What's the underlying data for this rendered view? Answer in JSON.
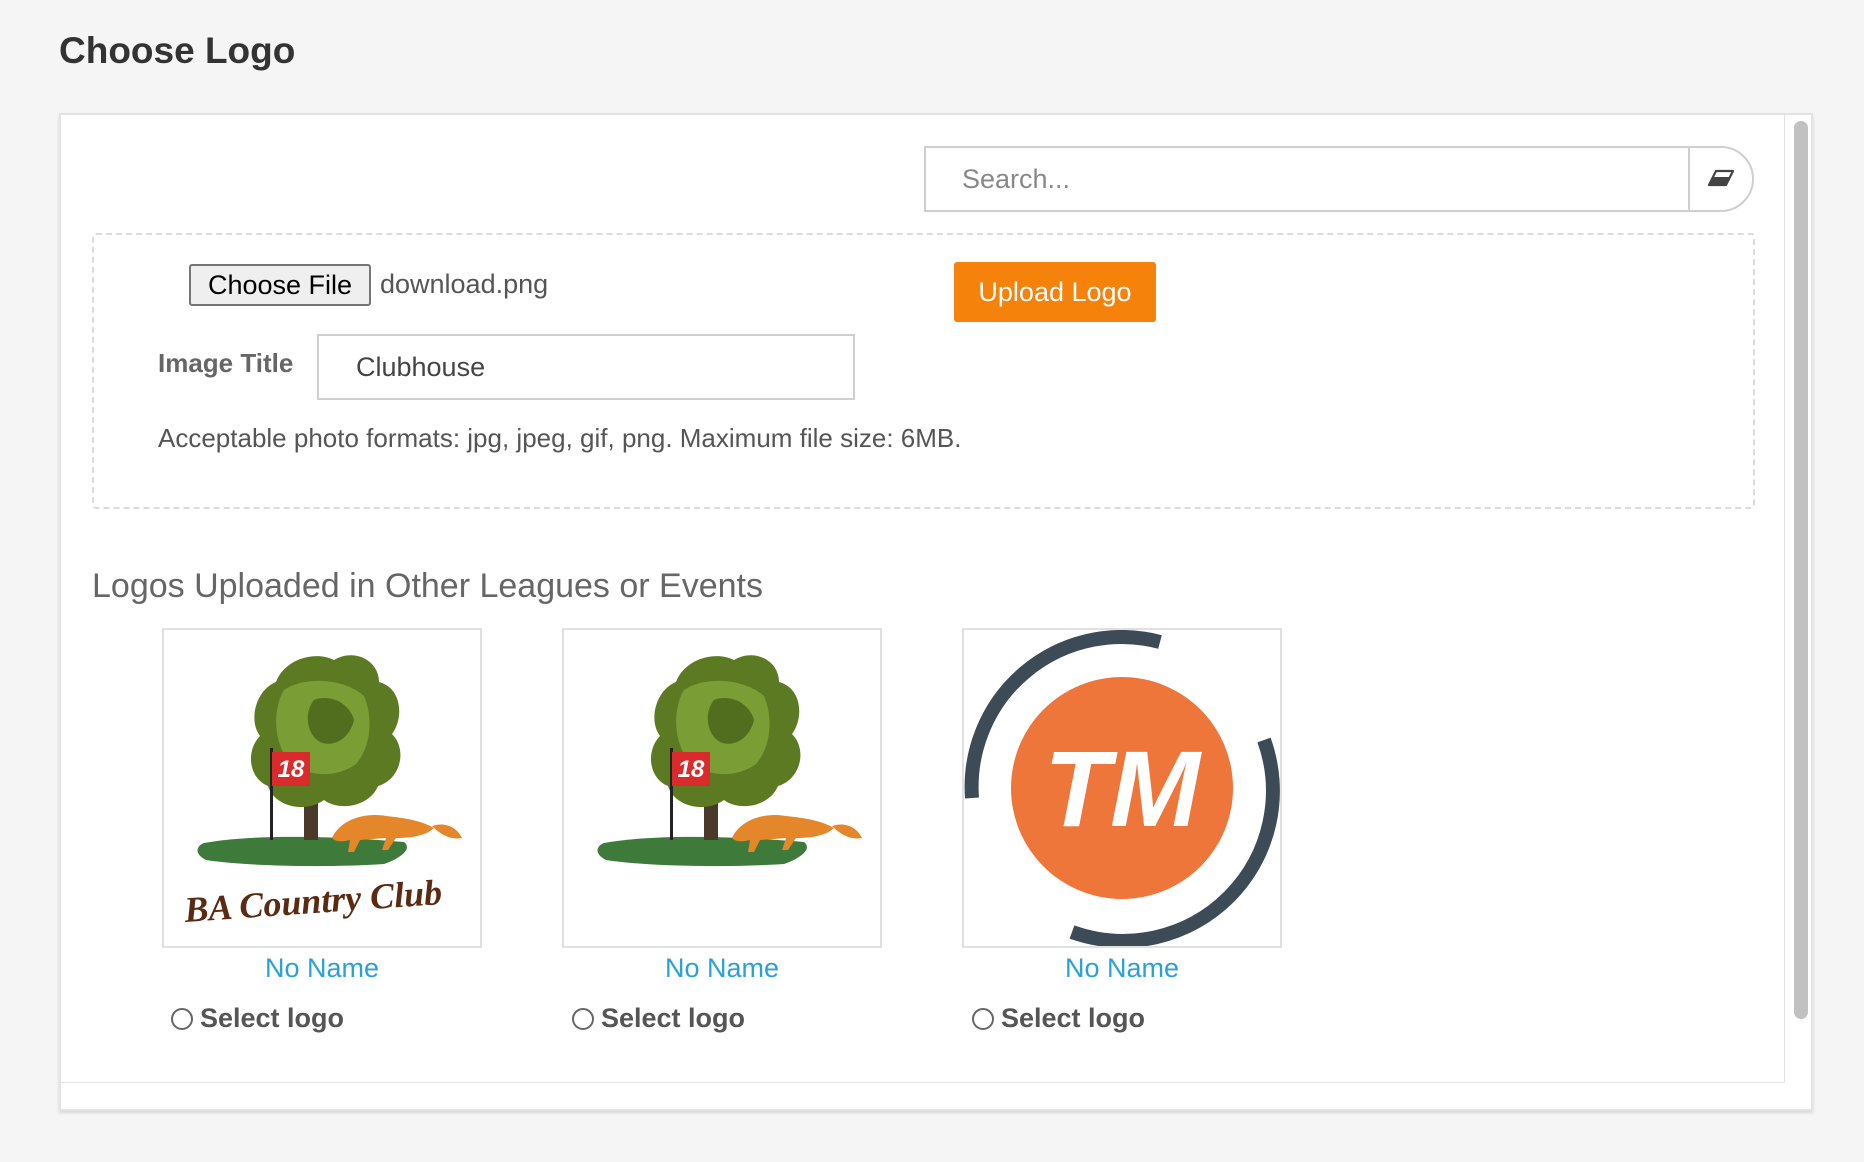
{
  "page": {
    "title": "Choose Logo"
  },
  "search": {
    "placeholder": "Search...",
    "value": ""
  },
  "upload": {
    "choose_file_label": "Choose File",
    "file_name": "download.png",
    "upload_button_label": "Upload Logo",
    "image_title_label": "Image Title",
    "image_title_value": "Clubhouse",
    "formats_note": "Acceptable photo formats: jpg, jpeg, gif, png. Maximum file size: 6MB."
  },
  "gallery": {
    "heading": "Logos Uploaded in Other Leagues or Events",
    "logos": [
      {
        "name": "No Name",
        "select_label": "Select logo",
        "image": "ba-country-club-tree-fox-logo",
        "logo_text": "BA Country Club",
        "flag_number": "18"
      },
      {
        "name": "No Name",
        "select_label": "Select logo",
        "image": "tree-fox-flag-logo",
        "flag_number": "18"
      },
      {
        "name": "No Name",
        "select_label": "Select logo",
        "image": "tm-circle-logo",
        "logo_text": "TM"
      }
    ]
  },
  "colors": {
    "accent": "#f5820b",
    "link": "#2aa1d4",
    "tm_orange": "#ee763b",
    "tm_ring": "#3d4b57"
  },
  "icons": {
    "clear_search": "eraser-icon"
  }
}
